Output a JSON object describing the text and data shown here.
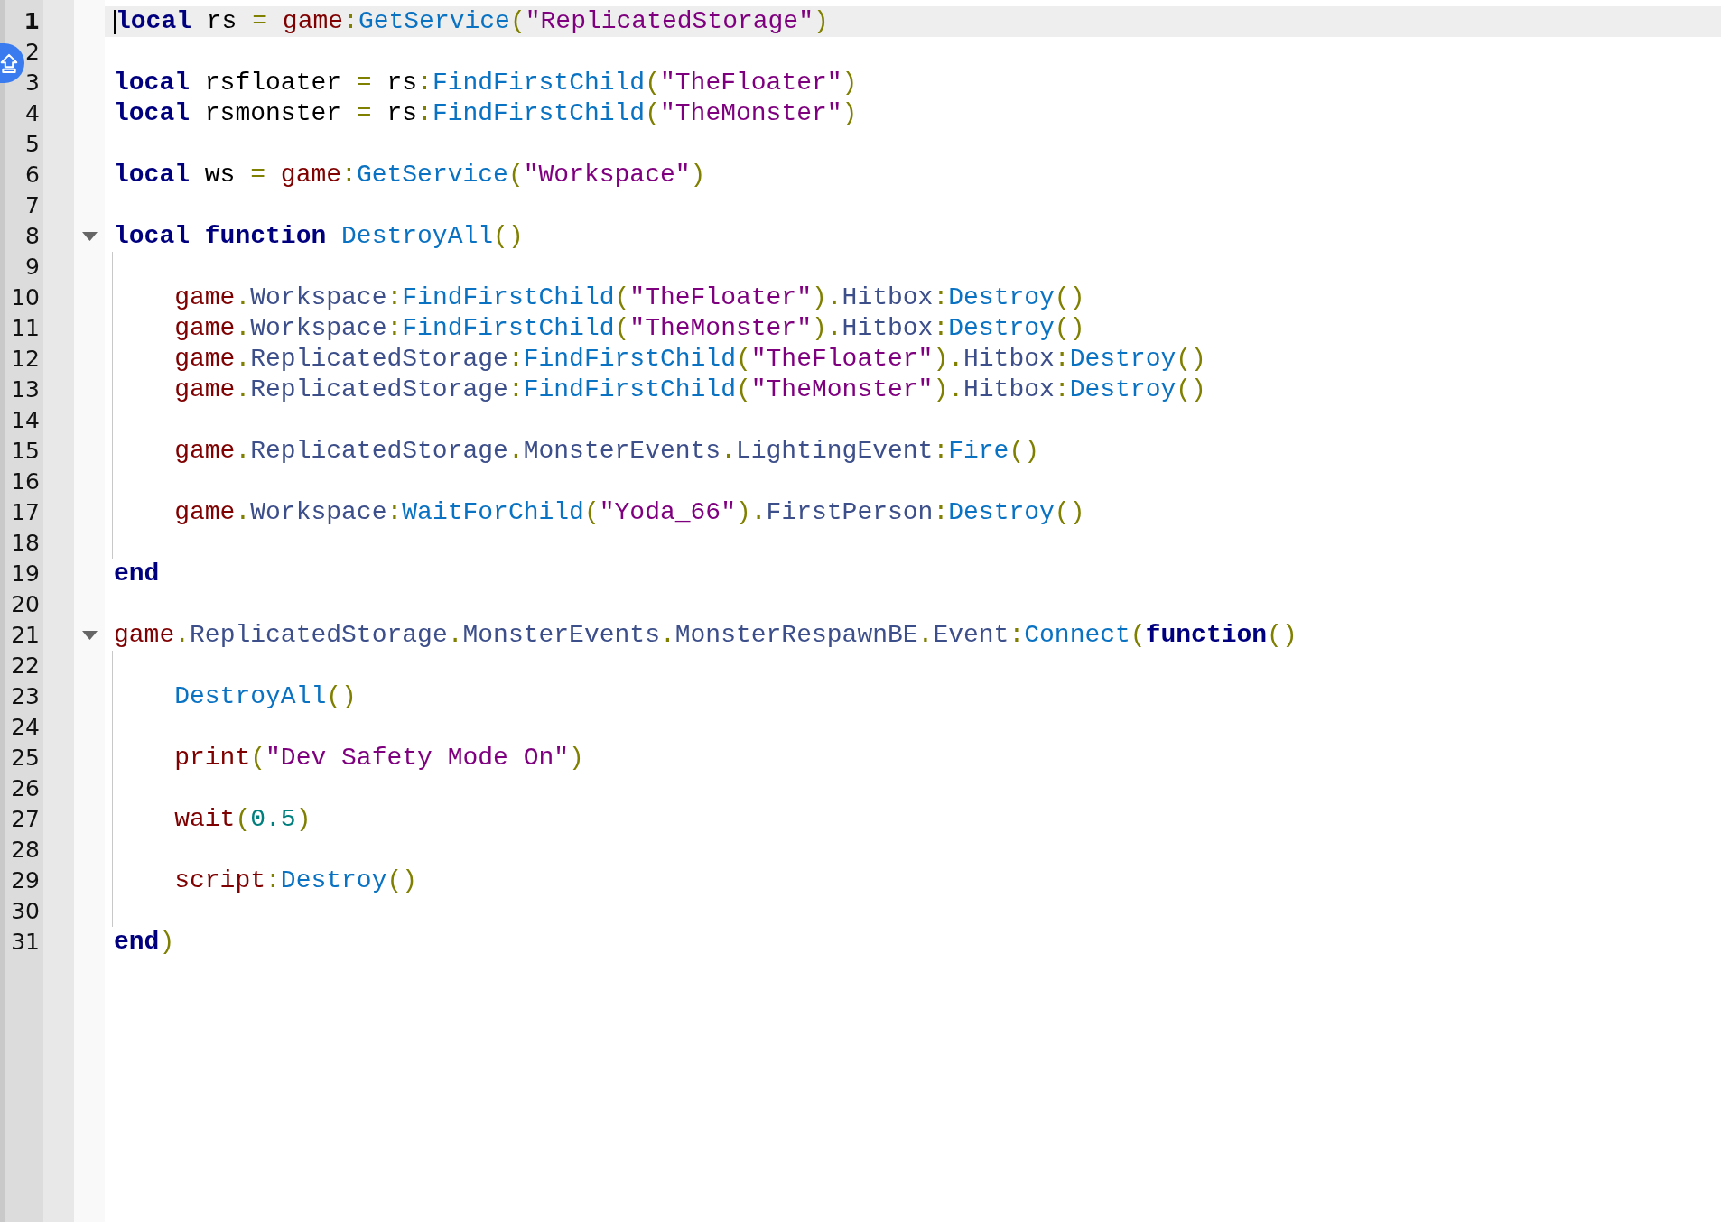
{
  "editor": {
    "lines": [
      {
        "number": "1",
        "current": true,
        "tokens": [
          {
            "text": "local",
            "kind": "keyword"
          },
          {
            "text": " rs ",
            "kind": "plain"
          },
          {
            "text": "= ",
            "kind": "operator"
          },
          {
            "text": "game",
            "kind": "global"
          },
          {
            "text": ":",
            "kind": "operator"
          },
          {
            "text": "GetService",
            "kind": "method"
          },
          {
            "text": "(",
            "kind": "operator"
          },
          {
            "text": "\"ReplicatedStorage\"",
            "kind": "string"
          },
          {
            "text": ")",
            "kind": "operator"
          }
        ]
      },
      {
        "number": "2",
        "current": false
      },
      {
        "number": "3",
        "current": false,
        "tokens": [
          {
            "text": "local",
            "kind": "keyword"
          },
          {
            "text": " rsfloater ",
            "kind": "plain"
          },
          {
            "text": "=",
            "kind": "operator"
          },
          {
            "text": " rs",
            "kind": "plain"
          },
          {
            "text": ":",
            "kind": "operator"
          },
          {
            "text": "FindFirstChild",
            "kind": "method"
          },
          {
            "text": "(",
            "kind": "operator"
          },
          {
            "text": "\"TheFloater\"",
            "kind": "string"
          },
          {
            "text": ")",
            "kind": "operator"
          }
        ]
      },
      {
        "number": "4",
        "current": false,
        "tokens": [
          {
            "text": "local",
            "kind": "keyword"
          },
          {
            "text": " rsmonster ",
            "kind": "plain"
          },
          {
            "text": "=",
            "kind": "operator"
          },
          {
            "text": " rs",
            "kind": "plain"
          },
          {
            "text": ":",
            "kind": "operator"
          },
          {
            "text": "FindFirstChild",
            "kind": "method"
          },
          {
            "text": "(",
            "kind": "operator"
          },
          {
            "text": "\"TheMonster\"",
            "kind": "string"
          },
          {
            "text": ")",
            "kind": "operator"
          }
        ]
      },
      {
        "number": "5",
        "current": false
      },
      {
        "number": "6",
        "current": false,
        "tokens": [
          {
            "text": "local",
            "kind": "keyword"
          },
          {
            "text": " ws ",
            "kind": "plain"
          },
          {
            "text": "= ",
            "kind": "operator"
          },
          {
            "text": "game",
            "kind": "global"
          },
          {
            "text": ":",
            "kind": "operator"
          },
          {
            "text": "GetService",
            "kind": "method"
          },
          {
            "text": "(",
            "kind": "operator"
          },
          {
            "text": "\"Workspace\"",
            "kind": "string"
          },
          {
            "text": ")",
            "kind": "operator"
          }
        ]
      },
      {
        "number": "7",
        "current": false
      },
      {
        "number": "8",
        "current": false,
        "expanded": true,
        "tokens": [
          {
            "text": "local function",
            "kind": "keyword"
          },
          {
            "text": " DestroyAll",
            "kind": "method"
          },
          {
            "text": "()",
            "kind": "operator"
          }
        ],
        "children": [
          {
            "number": "9",
            "current": false
          },
          {
            "number": "10",
            "current": false,
            "tokens": [
              {
                "text": "    game",
                "kind": "global"
              },
              {
                "text": ".",
                "kind": "operator"
              },
              {
                "text": "Workspace",
                "kind": "property"
              },
              {
                "text": ":",
                "kind": "operator"
              },
              {
                "text": "FindFirstChild",
                "kind": "method"
              },
              {
                "text": "(",
                "kind": "operator"
              },
              {
                "text": "\"TheFloater\"",
                "kind": "string"
              },
              {
                "text": ").",
                "kind": "operator"
              },
              {
                "text": "Hitbox",
                "kind": "property"
              },
              {
                "text": ":",
                "kind": "operator"
              },
              {
                "text": "Destroy",
                "kind": "method"
              },
              {
                "text": "()",
                "kind": "operator"
              }
            ]
          },
          {
            "number": "11",
            "current": false,
            "tokens": [
              {
                "text": "    game",
                "kind": "global"
              },
              {
                "text": ".",
                "kind": "operator"
              },
              {
                "text": "Workspace",
                "kind": "property"
              },
              {
                "text": ":",
                "kind": "operator"
              },
              {
                "text": "FindFirstChild",
                "kind": "method"
              },
              {
                "text": "(",
                "kind": "operator"
              },
              {
                "text": "\"TheMonster\"",
                "kind": "string"
              },
              {
                "text": ").",
                "kind": "operator"
              },
              {
                "text": "Hitbox",
                "kind": "property"
              },
              {
                "text": ":",
                "kind": "operator"
              },
              {
                "text": "Destroy",
                "kind": "method"
              },
              {
                "text": "()",
                "kind": "operator"
              }
            ]
          },
          {
            "number": "12",
            "current": false,
            "tokens": [
              {
                "text": "    game",
                "kind": "global"
              },
              {
                "text": ".",
                "kind": "operator"
              },
              {
                "text": "ReplicatedStorage",
                "kind": "property"
              },
              {
                "text": ":",
                "kind": "operator"
              },
              {
                "text": "FindFirstChild",
                "kind": "method"
              },
              {
                "text": "(",
                "kind": "operator"
              },
              {
                "text": "\"TheFloater\"",
                "kind": "string"
              },
              {
                "text": ").",
                "kind": "operator"
              },
              {
                "text": "Hitbox",
                "kind": "property"
              },
              {
                "text": ":",
                "kind": "operator"
              },
              {
                "text": "Destroy",
                "kind": "method"
              },
              {
                "text": "()",
                "kind": "operator"
              }
            ]
          },
          {
            "number": "13",
            "current": false,
            "tokens": [
              {
                "text": "    game",
                "kind": "global"
              },
              {
                "text": ".",
                "kind": "operator"
              },
              {
                "text": "ReplicatedStorage",
                "kind": "property"
              },
              {
                "text": ":",
                "kind": "operator"
              },
              {
                "text": "FindFirstChild",
                "kind": "method"
              },
              {
                "text": "(",
                "kind": "operator"
              },
              {
                "text": "\"TheMonster\"",
                "kind": "string"
              },
              {
                "text": ").",
                "kind": "operator"
              },
              {
                "text": "Hitbox",
                "kind": "property"
              },
              {
                "text": ":",
                "kind": "operator"
              },
              {
                "text": "Destroy",
                "kind": "method"
              },
              {
                "text": "()",
                "kind": "operator"
              }
            ]
          },
          {
            "number": "14",
            "current": false
          },
          {
            "number": "15",
            "current": false,
            "tokens": [
              {
                "text": "    game",
                "kind": "global"
              },
              {
                "text": ".",
                "kind": "operator"
              },
              {
                "text": "ReplicatedStorage",
                "kind": "property"
              },
              {
                "text": ".",
                "kind": "operator"
              },
              {
                "text": "MonsterEvents",
                "kind": "property"
              },
              {
                "text": ".",
                "kind": "operator"
              },
              {
                "text": "LightingEvent",
                "kind": "property"
              },
              {
                "text": ":",
                "kind": "operator"
              },
              {
                "text": "Fire",
                "kind": "method"
              },
              {
                "text": "()",
                "kind": "operator"
              }
            ]
          },
          {
            "number": "16",
            "current": false
          },
          {
            "number": "17",
            "current": false,
            "tokens": [
              {
                "text": "    game",
                "kind": "global"
              },
              {
                "text": ".",
                "kind": "operator"
              },
              {
                "text": "Workspace",
                "kind": "property"
              },
              {
                "text": ":",
                "kind": "operator"
              },
              {
                "text": "WaitForChild",
                "kind": "method"
              },
              {
                "text": "(",
                "kind": "operator"
              },
              {
                "text": "\"Yoda_66\"",
                "kind": "string"
              },
              {
                "text": ").",
                "kind": "operator"
              },
              {
                "text": "FirstPerson",
                "kind": "property"
              },
              {
                "text": ":",
                "kind": "operator"
              },
              {
                "text": "Destroy",
                "kind": "method"
              },
              {
                "text": "()",
                "kind": "operator"
              }
            ]
          },
          {
            "number": "18",
            "current": false
          }
        ]
      },
      {
        "number": "19",
        "current": false,
        "tokens": [
          {
            "text": "end",
            "kind": "keyword"
          }
        ]
      },
      {
        "number": "20",
        "current": false
      },
      {
        "number": "21",
        "current": false,
        "expanded": true,
        "tokens": [
          {
            "text": "game",
            "kind": "global"
          },
          {
            "text": ".",
            "kind": "operator"
          },
          {
            "text": "ReplicatedStorage",
            "kind": "property"
          },
          {
            "text": ".",
            "kind": "operator"
          },
          {
            "text": "MonsterEvents",
            "kind": "property"
          },
          {
            "text": ".",
            "kind": "operator"
          },
          {
            "text": "MonsterRespawnBE",
            "kind": "property"
          },
          {
            "text": ".",
            "kind": "operator"
          },
          {
            "text": "Event",
            "kind": "property"
          },
          {
            "text": ":",
            "kind": "operator"
          },
          {
            "text": "Connect",
            "kind": "method"
          },
          {
            "text": "(",
            "kind": "operator"
          },
          {
            "text": "function",
            "kind": "keyword"
          },
          {
            "text": "()",
            "kind": "operator"
          }
        ],
        "children": [
          {
            "number": "22",
            "current": false
          },
          {
            "number": "23",
            "current": false,
            "tokens": [
              {
                "text": "    DestroyAll",
                "kind": "method"
              },
              {
                "text": "()",
                "kind": "operator"
              }
            ]
          },
          {
            "number": "24",
            "current": false
          },
          {
            "number": "25",
            "current": false,
            "tokens": [
              {
                "text": "    print",
                "kind": "global"
              },
              {
                "text": "(",
                "kind": "operator"
              },
              {
                "text": "\"Dev Safety Mode On\"",
                "kind": "string"
              },
              {
                "text": ")",
                "kind": "operator"
              }
            ]
          },
          {
            "number": "26",
            "current": false
          },
          {
            "number": "27",
            "current": false,
            "tokens": [
              {
                "text": "    wait",
                "kind": "global"
              },
              {
                "text": "(",
                "kind": "operator"
              },
              {
                "text": "0.5",
                "kind": "number"
              },
              {
                "text": ")",
                "kind": "operator"
              }
            ]
          },
          {
            "number": "28",
            "current": false
          },
          {
            "number": "29",
            "current": false,
            "tokens": [
              {
                "text": "    script",
                "kind": "global"
              },
              {
                "text": ":",
                "kind": "operator"
              },
              {
                "text": "Destroy",
                "kind": "method"
              },
              {
                "text": "()",
                "kind": "operator"
              }
            ]
          },
          {
            "number": "30",
            "current": false
          }
        ]
      },
      {
        "number": "31",
        "current": false,
        "tokens": [
          {
            "text": "end",
            "kind": "keyword"
          },
          {
            "text": ")",
            "kind": "operator"
          }
        ]
      }
    ]
  }
}
